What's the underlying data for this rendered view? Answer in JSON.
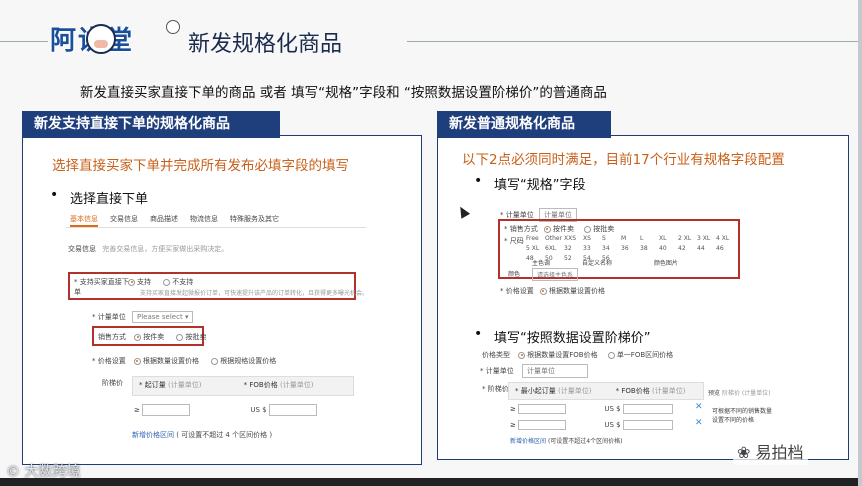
{
  "header": {
    "logo_text": "阿讲堂",
    "title": "新发规格化商品"
  },
  "subtitle": "新发直接买家直接下单的商品 或者 填写“规格”字段和 “按照数据设置阶梯价”的普通商品",
  "left_panel": {
    "tab": "新发支持直接下单的规格化商品",
    "note": "选择直接买家下单并完成所有发布必填字段的填写",
    "bullet": "选择直接下单",
    "form": {
      "tabs": [
        "基本信息",
        "交易信息",
        "商品描述",
        "物流信息",
        "特殊服务及其它"
      ],
      "section": "交易信息",
      "section_hint": "完善交易信息，方便买家做出采购决定。",
      "direct_order_label": "* 支持买家直接下单",
      "direct_order_yes": "支持",
      "direct_order_no": "不支持",
      "direct_order_hint": "支持买家直接发起微报价订单，可快速提升该产品的订单转化，且获得更多曝光机会。",
      "unit_label": "* 计量单位",
      "unit_placeholder": "Please select",
      "sale_label": "销售方式",
      "sale_option_a": "按件卖",
      "sale_option_b": "按批卖",
      "price_label": "* 价格设置",
      "price_option_a": "根据数量设置价格",
      "price_option_b": "根据规格设置价格",
      "tier_label": "阶梯价",
      "col_min": "* 起订量",
      "col_min_hint": "(计量单位)",
      "col_fob": "* FOB价格",
      "col_fob_hint": "(计量单位)",
      "ge_sign": "≥",
      "currency": "US $",
      "add_tier": "新增价格区间",
      "add_tier_hint": "( 可设置不超过 4 个区间价格 )"
    }
  },
  "right_panel": {
    "tab": "新发普通规格化商品",
    "note": "以下2点必须同时满足，目前17个行业有规格字段配置",
    "bullet1": "填写“规格”字段",
    "bullet2": "填写“按照数据设置阶梯价”",
    "form1": {
      "unit_label": "* 计量单位",
      "unit_value": "计量单位",
      "sale_label": "* 销售方式",
      "sale_a": "按件卖",
      "sale_b": "按批卖",
      "size_label": "* 尺码",
      "sizes": [
        "Free",
        "Other",
        "XXS",
        "XS",
        "S",
        "M",
        "L",
        "XL",
        "2 XL",
        "3 XL",
        "4 XL",
        "5 XL",
        "6XL",
        "32",
        "33",
        "34",
        "36",
        "38",
        "40",
        "42",
        "44",
        "46",
        "48",
        "50",
        "52",
        "54",
        "56"
      ],
      "main_color": "主色调",
      "custom_name": "自定义名称",
      "color_image": "颜色图片",
      "color_label": "颜色",
      "pick_color": "请选择主色系",
      "price_label": "* 价格设置",
      "price_value": "根据数量设置价格"
    },
    "form2": {
      "price_type_label": "价格类型",
      "price_type_a": "根据数量设置FOB价格",
      "price_type_b": "单一FOB区间价格",
      "unit_label": "* 计量单位",
      "unit_value": "计量单位",
      "tier_label": "* 阶梯价",
      "col_min": "* 最小起订量",
      "col_min_hint": "(计量单位)",
      "col_fob": "* FOB价格",
      "col_fob_hint": "(计量单位)",
      "ge_sign": "≥",
      "currency": "US $",
      "add_tier": "新增价格区间",
      "add_tier_hint": "(可设置不超过4个区间价格)",
      "preview_label": "预览",
      "preview_hint": "阶梯价 (计量单位)",
      "preview_text": "可根据不同的销售数量设置不同的价格"
    }
  },
  "watermarks": {
    "left": "大数跨境",
    "right": "易拍档"
  }
}
